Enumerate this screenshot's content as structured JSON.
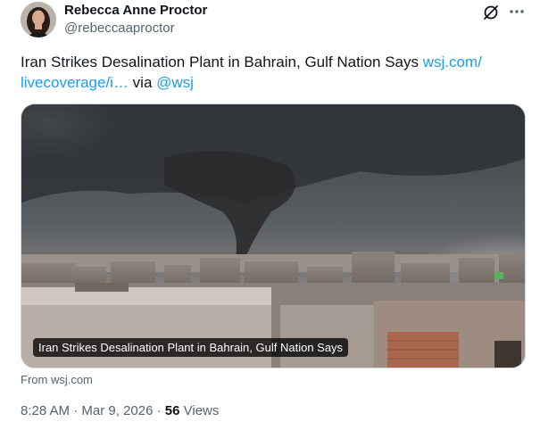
{
  "author": {
    "name": "Rebecca Anne Proctor",
    "handle": "@rebeccaaproctor"
  },
  "icons": {
    "grok": "grok-icon",
    "more": "more-icon"
  },
  "tweet": {
    "text_prefix": "Iran Strikes Desalination Plant in Bahrain, Gulf Nation Says ",
    "link_line1": "wsj.com/",
    "link_line2": "livecoverage/i…",
    "via": " via ",
    "mention": "@wsj"
  },
  "card": {
    "caption": "Iran Strikes Desalination Plant in Bahrain, Gulf Nation Says",
    "source": "From wsj.com"
  },
  "meta": {
    "time": "8:28 AM",
    "sep1": " · ",
    "date": "Mar 9, 2026",
    "sep2": " · ",
    "views_count": "56",
    "views_label": " Views"
  },
  "colors": {
    "link": "#1d9bf0",
    "secondary_text": "#536471",
    "primary_text": "#0f1419"
  }
}
